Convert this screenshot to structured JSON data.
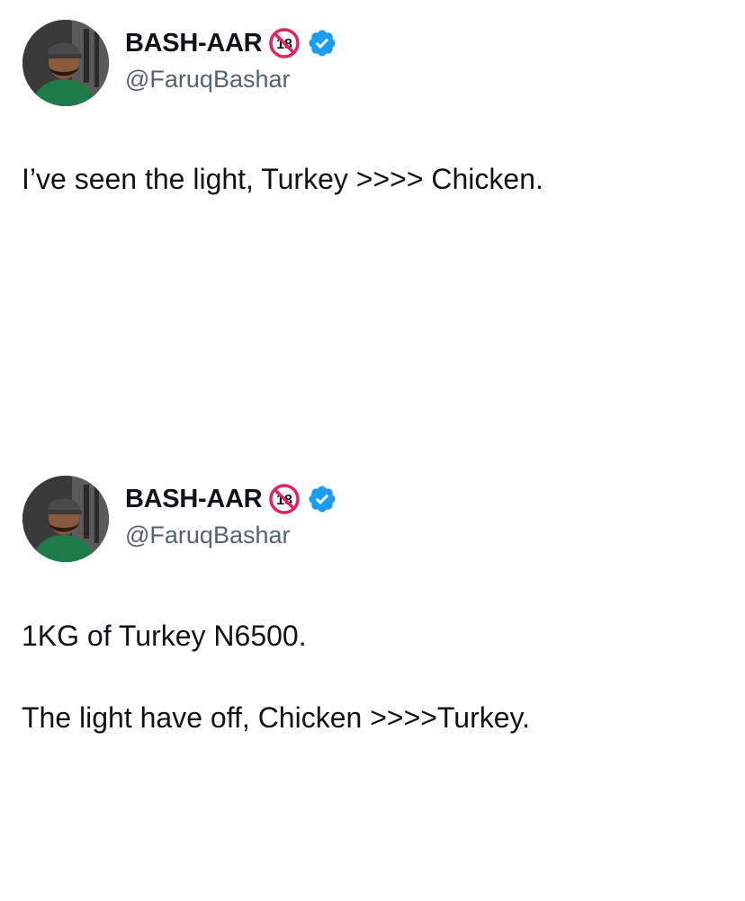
{
  "tweets": [
    {
      "author": {
        "display_name": "BASH-AAR",
        "age_badge": "18",
        "verified_icon": "verified-badge-icon",
        "handle": "@FaruqBashar"
      },
      "lines": [
        "I’ve seen the light, Turkey >>>> Chicken."
      ]
    },
    {
      "author": {
        "display_name": "BASH-AAR",
        "age_badge": "18",
        "verified_icon": "verified-badge-icon",
        "handle": "@FaruqBashar"
      },
      "lines": [
        "1KG of Turkey N6500.",
        "The light have off, Chicken >>>>Turkey."
      ]
    }
  ],
  "colors": {
    "text": "#0f1419",
    "handle": "#536471",
    "verified": "#1d9bf0",
    "age_badge": "#e0245e"
  }
}
